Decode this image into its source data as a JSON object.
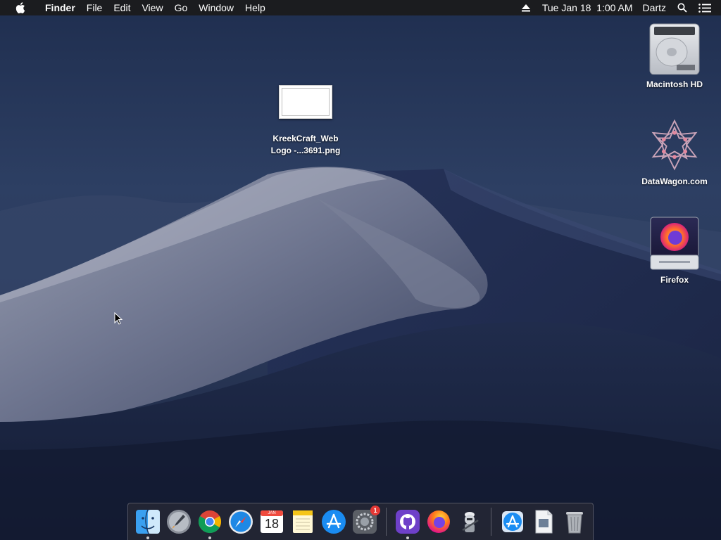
{
  "menubar": {
    "apple_icon": "apple-icon",
    "app_name": "Finder",
    "menus": [
      "File",
      "Edit",
      "View",
      "Go",
      "Window",
      "Help"
    ],
    "status": {
      "eject_icon": "eject-icon",
      "datetime": "Tue Jan 18  1:00 AM",
      "user": "Dartz",
      "search_icon": "spotlight-search-icon",
      "notifications_icon": "notification-center-icon"
    }
  },
  "desktop": {
    "icons": [
      {
        "label_line1": "KreekCraft_Web",
        "label_line2": "Logo -...3691.png",
        "icon": "png-file-icon"
      },
      {
        "label": "Macintosh HD",
        "icon": "hard-drive-icon"
      },
      {
        "label": "DataWagon.com",
        "icon": "datawagon-logo-icon"
      },
      {
        "label": "Firefox",
        "icon": "firefox-disk-image-icon"
      }
    ]
  },
  "dock": {
    "items": [
      {
        "name": "Finder",
        "icon": "finder-icon",
        "running": true
      },
      {
        "name": "Launchpad",
        "icon": "launchpad-icon",
        "running": false
      },
      {
        "name": "Google Chrome",
        "icon": "chrome-icon",
        "running": true
      },
      {
        "name": "Safari",
        "icon": "safari-icon",
        "running": false
      },
      {
        "name": "Calendar",
        "icon": "calendar-icon",
        "running": false,
        "month": "JAN",
        "day": "18"
      },
      {
        "name": "Notes",
        "icon": "notes-icon",
        "running": false
      },
      {
        "name": "App Store",
        "icon": "app-store-icon",
        "running": false
      },
      {
        "name": "System Preferences",
        "icon": "system-preferences-icon",
        "running": false,
        "badge": "1"
      },
      {
        "name": "GitHub Desktop",
        "icon": "github-icon",
        "running": true
      },
      {
        "name": "Firefox",
        "icon": "firefox-icon",
        "running": false
      },
      {
        "name": "Automator",
        "icon": "automator-icon",
        "running": false
      },
      {
        "name": "Downloads",
        "icon": "app-store-download-icon",
        "running": false
      },
      {
        "name": "Document",
        "icon": "document-icon",
        "running": false
      },
      {
        "name": "Trash",
        "icon": "trash-icon",
        "running": false
      }
    ]
  },
  "colors": {
    "menubar_bg": "#1b1c1f",
    "sky": "#2a3b5e",
    "dune_light": "#8e93a6",
    "dune_shadow": "#1d2947",
    "badge": "#e53935"
  }
}
